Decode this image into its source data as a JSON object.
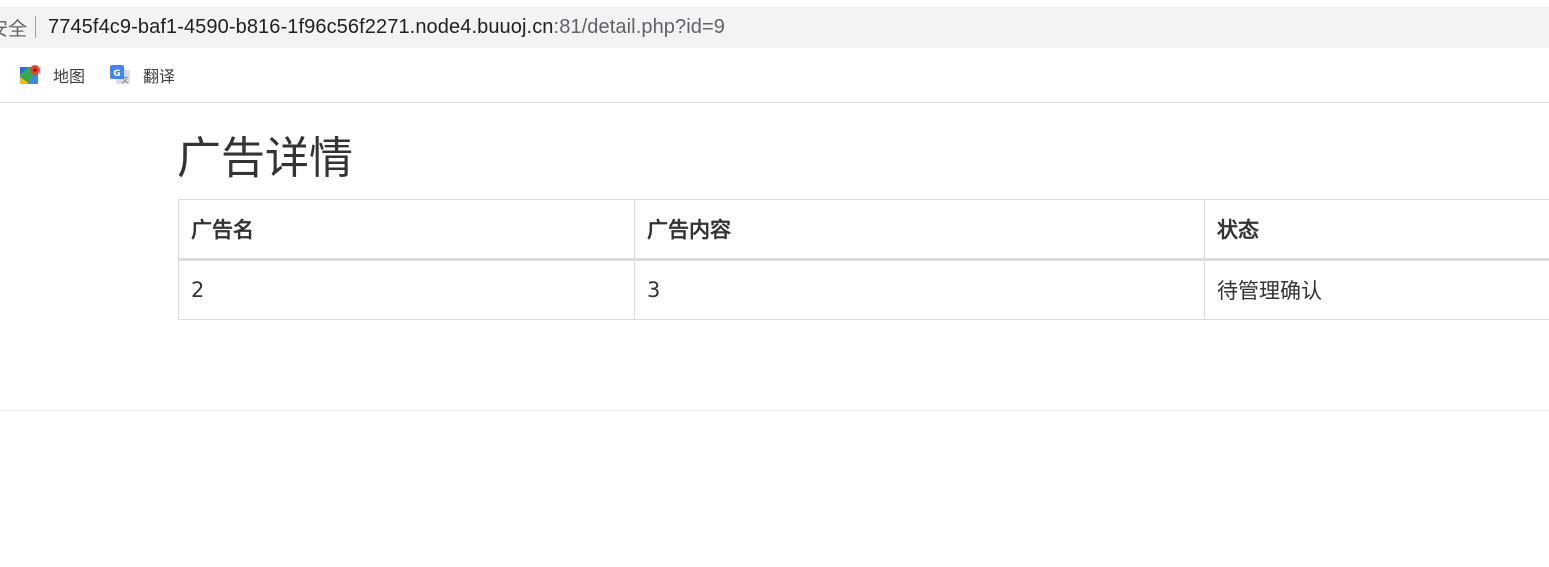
{
  "browser": {
    "security_label": "安全",
    "url_host": "7745f4c9-baf1-4590-b816-1f96c56f2271.node4.buuoj.cn",
    "url_rest": ":81/detail.php?id=9",
    "bookmarks": [
      {
        "label": "地图",
        "icon": "maps-icon"
      },
      {
        "label": "翻译",
        "icon": "translate-icon"
      }
    ]
  },
  "page": {
    "title": "广告详情",
    "table": {
      "headers": [
        "广告名",
        "广告内容",
        "状态"
      ],
      "rows": [
        [
          "2",
          "3",
          "待管理确认"
        ]
      ]
    }
  },
  "colors": {
    "address_bar_bg": "#f1f3f4",
    "text": "#333333",
    "border": "#dddddd"
  }
}
